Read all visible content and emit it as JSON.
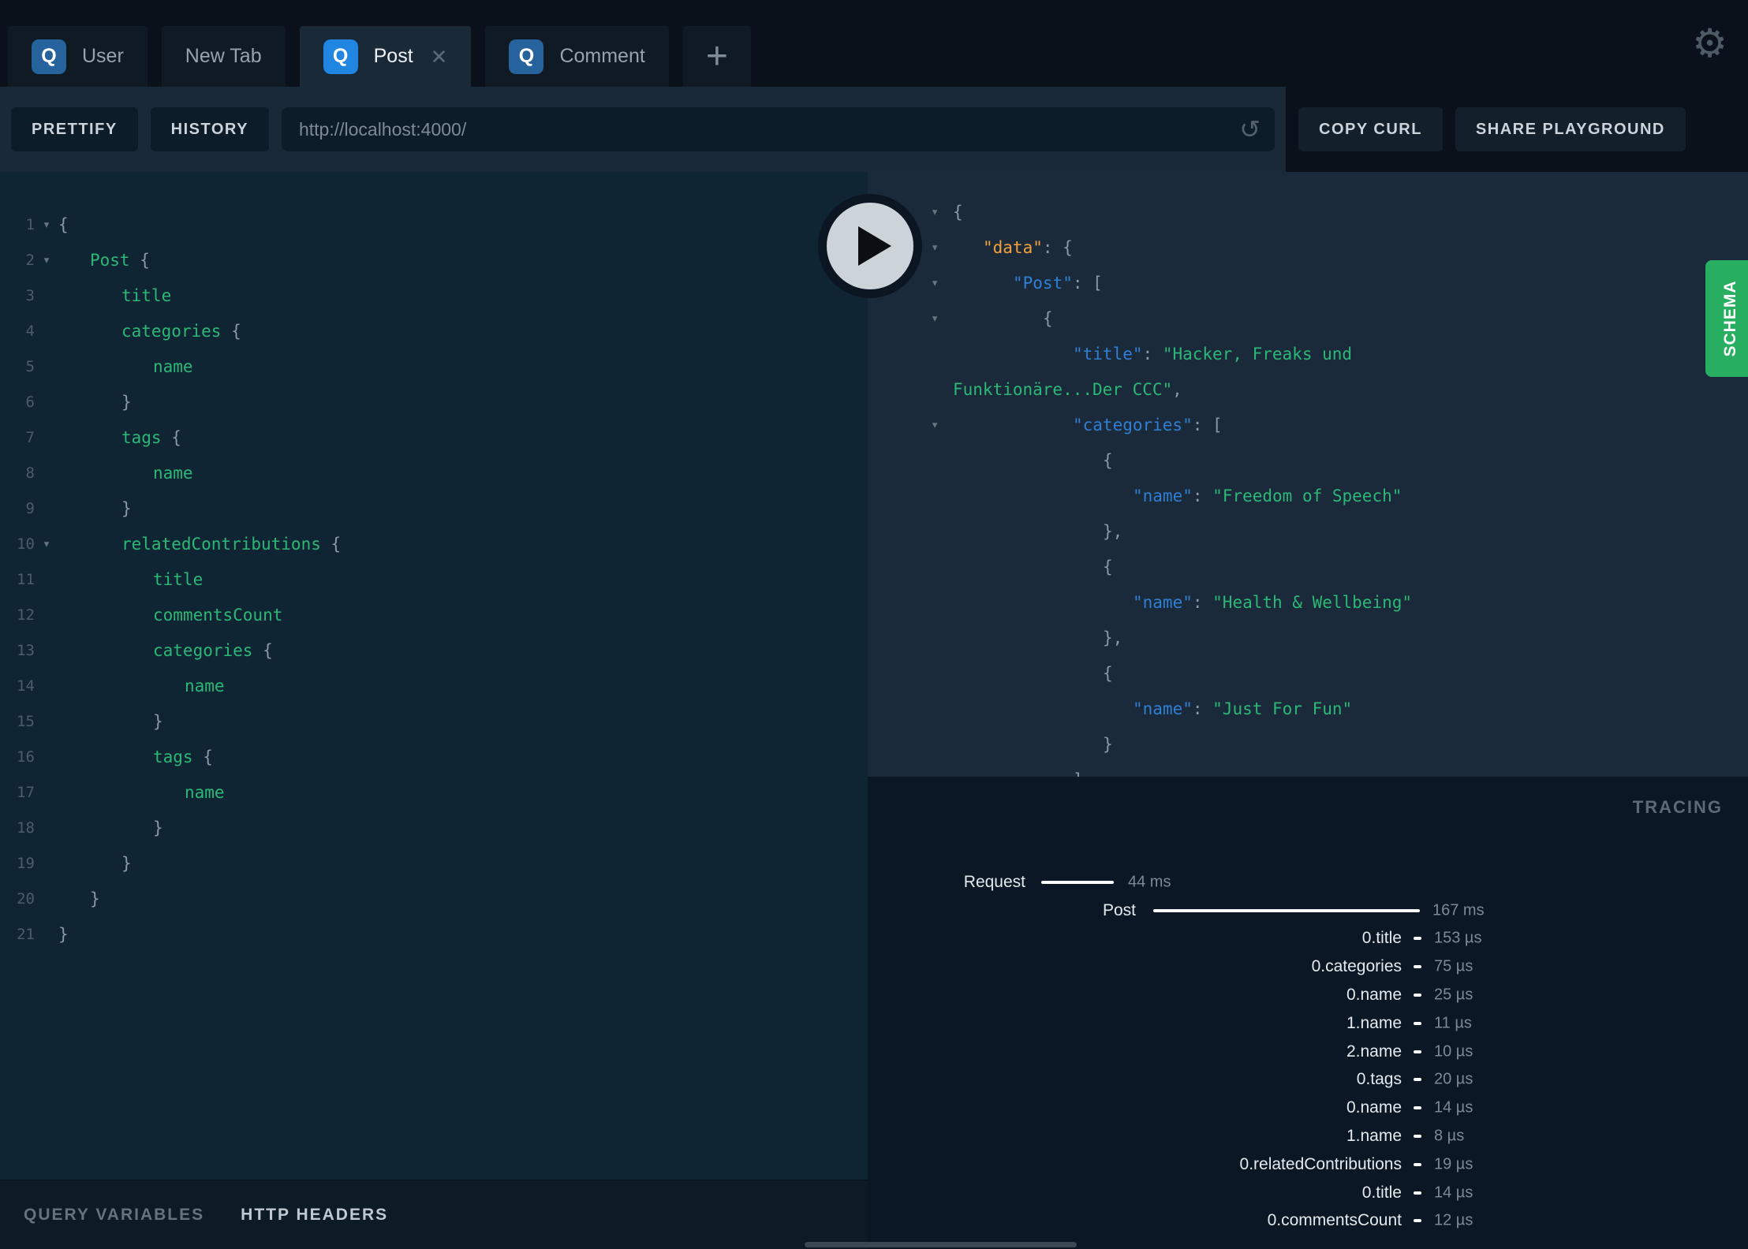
{
  "topbar": {
    "tabs": [
      {
        "label": "User",
        "badge": "Q",
        "active": false,
        "closable": false
      },
      {
        "label": "New Tab",
        "badge": "",
        "active": false,
        "closable": false
      },
      {
        "label": "Post",
        "badge": "Q",
        "active": true,
        "closable": true
      },
      {
        "label": "Comment",
        "badge": "Q",
        "active": false,
        "closable": false
      }
    ],
    "add_tab_label": "+",
    "close_icon": "✕",
    "gear_icon": "⚙"
  },
  "toolbar": {
    "prettify_label": "PRETTIFY",
    "history_label": "HISTORY",
    "url_value": "http://localhost:4000/",
    "reload_icon": "↺",
    "copy_curl_label": "COPY CURL",
    "share_label": "SHARE PLAYGROUND"
  },
  "query_editor": {
    "fold_icon": "▾",
    "lines": [
      {
        "n": 1,
        "i": 0,
        "fold": true,
        "t": [
          [
            "{",
            "p"
          ]
        ]
      },
      {
        "n": 2,
        "i": 1,
        "fold": true,
        "t": [
          [
            "Post ",
            "f"
          ],
          [
            "{",
            "p"
          ]
        ]
      },
      {
        "n": 3,
        "i": 2,
        "fold": false,
        "t": [
          [
            "title",
            "f"
          ]
        ]
      },
      {
        "n": 4,
        "i": 2,
        "fold": false,
        "t": [
          [
            "categories ",
            "f"
          ],
          [
            "{",
            "p"
          ]
        ]
      },
      {
        "n": 5,
        "i": 3,
        "fold": false,
        "t": [
          [
            "name",
            "f"
          ]
        ]
      },
      {
        "n": 6,
        "i": 2,
        "fold": false,
        "t": [
          [
            "}",
            "p"
          ]
        ]
      },
      {
        "n": 7,
        "i": 2,
        "fold": false,
        "t": [
          [
            "tags ",
            "f"
          ],
          [
            "{",
            "p"
          ]
        ]
      },
      {
        "n": 8,
        "i": 3,
        "fold": false,
        "t": [
          [
            "name",
            "f"
          ]
        ]
      },
      {
        "n": 9,
        "i": 2,
        "fold": false,
        "t": [
          [
            "}",
            "p"
          ]
        ]
      },
      {
        "n": 10,
        "i": 2,
        "fold": true,
        "t": [
          [
            "relatedContributions ",
            "f"
          ],
          [
            "{",
            "p"
          ]
        ]
      },
      {
        "n": 11,
        "i": 3,
        "fold": false,
        "t": [
          [
            "title",
            "f"
          ]
        ]
      },
      {
        "n": 12,
        "i": 3,
        "fold": false,
        "t": [
          [
            "commentsCount",
            "f"
          ]
        ]
      },
      {
        "n": 13,
        "i": 3,
        "fold": false,
        "t": [
          [
            "categories ",
            "f"
          ],
          [
            "{",
            "p"
          ]
        ]
      },
      {
        "n": 14,
        "i": 4,
        "fold": false,
        "t": [
          [
            "name",
            "f"
          ]
        ]
      },
      {
        "n": 15,
        "i": 3,
        "fold": false,
        "t": [
          [
            "}",
            "p"
          ]
        ]
      },
      {
        "n": 16,
        "i": 3,
        "fold": false,
        "t": [
          [
            "tags ",
            "f"
          ],
          [
            "{",
            "p"
          ]
        ]
      },
      {
        "n": 17,
        "i": 4,
        "fold": false,
        "t": [
          [
            "name",
            "f"
          ]
        ]
      },
      {
        "n": 18,
        "i": 3,
        "fold": false,
        "t": [
          [
            "}",
            "p"
          ]
        ]
      },
      {
        "n": 19,
        "i": 2,
        "fold": false,
        "t": [
          [
            "}",
            "p"
          ]
        ]
      },
      {
        "n": 20,
        "i": 1,
        "fold": false,
        "t": [
          [
            "}",
            "p"
          ]
        ]
      },
      {
        "n": 21,
        "i": 0,
        "fold": false,
        "t": [
          [
            "}",
            "p"
          ]
        ]
      }
    ]
  },
  "response_viewer": {
    "fold_icon": "▾",
    "lines": [
      {
        "i": 0,
        "fold": true,
        "t": [
          [
            "{",
            "p"
          ]
        ]
      },
      {
        "i": 1,
        "fold": true,
        "t": [
          [
            "\"data\"",
            "d"
          ],
          [
            ": {",
            "p"
          ]
        ]
      },
      {
        "i": 2,
        "fold": true,
        "t": [
          [
            "\"Post\"",
            "k"
          ],
          [
            ": [",
            "p"
          ]
        ]
      },
      {
        "i": 3,
        "fold": true,
        "t": [
          [
            "{",
            "p"
          ]
        ]
      },
      {
        "i": 4,
        "fold": false,
        "t": [
          [
            "\"title\"",
            "k"
          ],
          [
            ": ",
            "p"
          ],
          [
            "\"Hacker, Freaks und",
            "s"
          ]
        ]
      },
      {
        "i": 0,
        "fold": false,
        "t": [
          [
            "Funktionäre...Der CCC\"",
            "s"
          ],
          [
            ",",
            "p"
          ]
        ]
      },
      {
        "i": 4,
        "fold": true,
        "t": [
          [
            "\"categories\"",
            "k"
          ],
          [
            ": [",
            "p"
          ]
        ]
      },
      {
        "i": 5,
        "fold": false,
        "t": [
          [
            "{",
            "p"
          ]
        ]
      },
      {
        "i": 6,
        "fold": false,
        "t": [
          [
            "\"name\"",
            "k"
          ],
          [
            ": ",
            "p"
          ],
          [
            "\"Freedom of Speech\"",
            "s"
          ]
        ]
      },
      {
        "i": 5,
        "fold": false,
        "t": [
          [
            "},",
            "p"
          ]
        ]
      },
      {
        "i": 5,
        "fold": false,
        "t": [
          [
            "{",
            "p"
          ]
        ]
      },
      {
        "i": 6,
        "fold": false,
        "t": [
          [
            "\"name\"",
            "k"
          ],
          [
            ": ",
            "p"
          ],
          [
            "\"Health & Wellbeing\"",
            "s"
          ]
        ]
      },
      {
        "i": 5,
        "fold": false,
        "t": [
          [
            "},",
            "p"
          ]
        ]
      },
      {
        "i": 5,
        "fold": false,
        "t": [
          [
            "{",
            "p"
          ]
        ]
      },
      {
        "i": 6,
        "fold": false,
        "t": [
          [
            "\"name\"",
            "k"
          ],
          [
            ": ",
            "p"
          ],
          [
            "\"Just For Fun\"",
            "s"
          ]
        ]
      },
      {
        "i": 5,
        "fold": false,
        "t": [
          [
            "}",
            "p"
          ]
        ]
      },
      {
        "i": 4,
        "fold": false,
        "t": [
          [
            "]",
            "p"
          ]
        ]
      }
    ]
  },
  "schema_tab": {
    "label": "SCHEMA",
    "color": "#27ae60"
  },
  "tracing": {
    "title": "TRACING",
    "rows": [
      {
        "label": "Request",
        "value": "44 ms",
        "kind": "request"
      },
      {
        "label": "Post",
        "value": "167 ms",
        "kind": "post"
      },
      {
        "label": "0.title",
        "value": "153 µs",
        "kind": "field"
      },
      {
        "label": "0.categories",
        "value": "75 µs",
        "kind": "field"
      },
      {
        "label": "0.name",
        "value": "25 µs",
        "kind": "field"
      },
      {
        "label": "1.name",
        "value": "11 µs",
        "kind": "field"
      },
      {
        "label": "2.name",
        "value": "10 µs",
        "kind": "field"
      },
      {
        "label": "0.tags",
        "value": "20 µs",
        "kind": "field"
      },
      {
        "label": "0.name",
        "value": "14 µs",
        "kind": "field"
      },
      {
        "label": "1.name",
        "value": "8 µs",
        "kind": "field"
      },
      {
        "label": "0.relatedContributions",
        "value": "19 µs",
        "kind": "field"
      },
      {
        "label": "0.title",
        "value": "14 µs",
        "kind": "field"
      },
      {
        "label": "0.commentsCount",
        "value": "12 µs",
        "kind": "field"
      }
    ]
  },
  "bottom_bar": {
    "query_variables_label": "QUERY VARIABLES",
    "http_headers_label": "HTTP HEADERS"
  },
  "colors": {
    "accent_green": "#27ae60",
    "badge_blue_active": "#2185e2",
    "badge_blue": "#26639c",
    "syntax_green": "#2bb876",
    "syntax_blue": "#2f7fd4",
    "syntax_orange": "#f3a13c"
  }
}
